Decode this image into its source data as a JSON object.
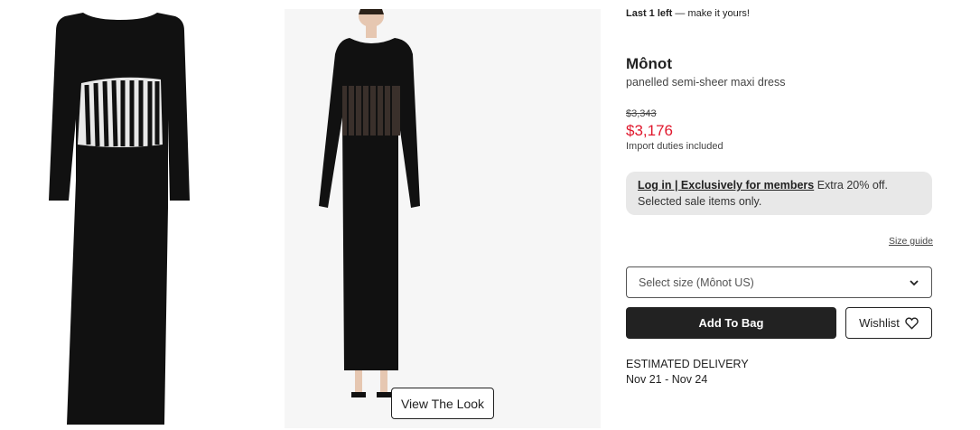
{
  "stock": {
    "emphasis": "Last 1 left",
    "rest": " — make it yours!"
  },
  "product": {
    "brand": "Mônot",
    "name": "panelled semi-sheer maxi dress",
    "original_price": "$3,343",
    "sale_price": "$3,176",
    "duties_note": "Import duties included"
  },
  "promo": {
    "link": "Log in | Exclusively for members",
    "text1": " Extra 20% off.",
    "text2": "Selected sale items only."
  },
  "size_guide": "Size guide",
  "size_select": {
    "placeholder": "Select size (Mônot US)",
    "icon": "chevron-down-icon"
  },
  "buttons": {
    "add_to_bag": "Add To Bag",
    "wishlist": "Wishlist",
    "wishlist_icon": "heart-icon"
  },
  "delivery": {
    "label": "ESTIMATED DELIVERY",
    "dates": "Nov 21 - Nov 24"
  },
  "gallery": {
    "view_look": "View The Look"
  },
  "colors": {
    "sale": "#e0182d",
    "primary_button": "#222222",
    "promo_bg": "#e8e8e8",
    "image_bg": "#f6f6f6"
  }
}
